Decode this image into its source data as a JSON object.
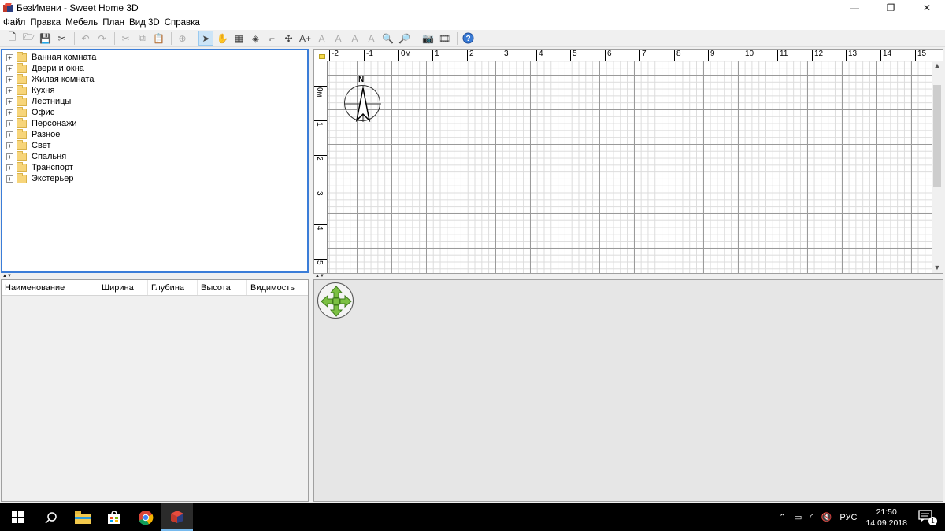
{
  "window": {
    "title": "БезИмени - Sweet Home 3D",
    "controls": {
      "minimize": "—",
      "restore": "❐",
      "close": "✕"
    }
  },
  "menu": [
    "Файл",
    "Правка",
    "Мебель",
    "План",
    "Вид 3D",
    "Справка"
  ],
  "catalog": {
    "categories": [
      "Ванная комната",
      "Двери и окна",
      "Жилая комната",
      "Кухня",
      "Лестницы",
      "Офис",
      "Персонажи",
      "Разное",
      "Свет",
      "Спальня",
      "Транспорт",
      "Экстерьер"
    ]
  },
  "furniture_table": {
    "columns": [
      "Наименование",
      "Ширина",
      "Глубина",
      "Высота",
      "Видимость"
    ]
  },
  "plan": {
    "ruler_top": [
      "-2",
      "-1",
      "0м",
      "1",
      "2",
      "3",
      "4",
      "5",
      "6",
      "7",
      "8",
      "9",
      "10",
      "11",
      "12",
      "13",
      "14",
      "15"
    ],
    "ruler_left": [
      "0м",
      "1",
      "2",
      "3",
      "4",
      "5"
    ],
    "compass_label": "N"
  },
  "taskbar": {
    "language": "РУС",
    "time": "21:50",
    "date": "14.09.2018",
    "notifications": "1"
  }
}
